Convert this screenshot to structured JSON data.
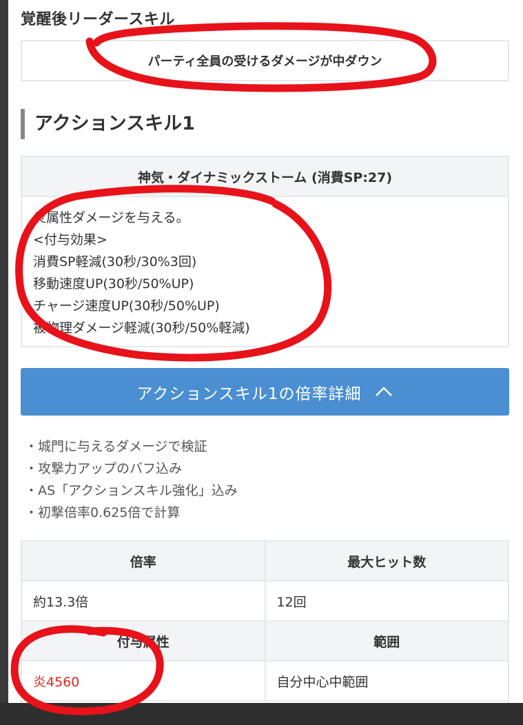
{
  "leader_skill": {
    "heading": "覚醒後リーダースキル",
    "text": "パーティ全員の受けるダメージが中ダウン"
  },
  "action_skill": {
    "heading": "アクションスキル1",
    "name": "神気・ダイナミックストーム (消費SP:27)",
    "lines": [
      "炎属性ダメージを与える。",
      "<付与効果>",
      "消費SP軽減(30秒/30%3回)",
      "移動速度UP(30秒/50%UP)",
      "チャージ速度UP(30秒/50%UP)",
      "被物理ダメージ軽減(30秒/50%軽減)"
    ]
  },
  "detail_button": {
    "label": "アクションスキル1の倍率詳細",
    "icon": "chevron-up-icon",
    "color": "#4a8fd1"
  },
  "notes": [
    "・城門に与えるダメージで検証",
    "・攻撃力アップのバフ込み",
    "・AS「アクションスキル強化」込み",
    "・初撃倍率0.625倍で計算"
  ],
  "stats": {
    "headers1": [
      "倍率",
      "最大ヒット数"
    ],
    "values1": [
      "約13.3倍",
      "12回"
    ],
    "headers2": [
      "付与属性",
      "範囲"
    ],
    "values2": [
      "炎4560",
      "自分中心中範囲"
    ]
  },
  "annotation_color": "#e8121a"
}
